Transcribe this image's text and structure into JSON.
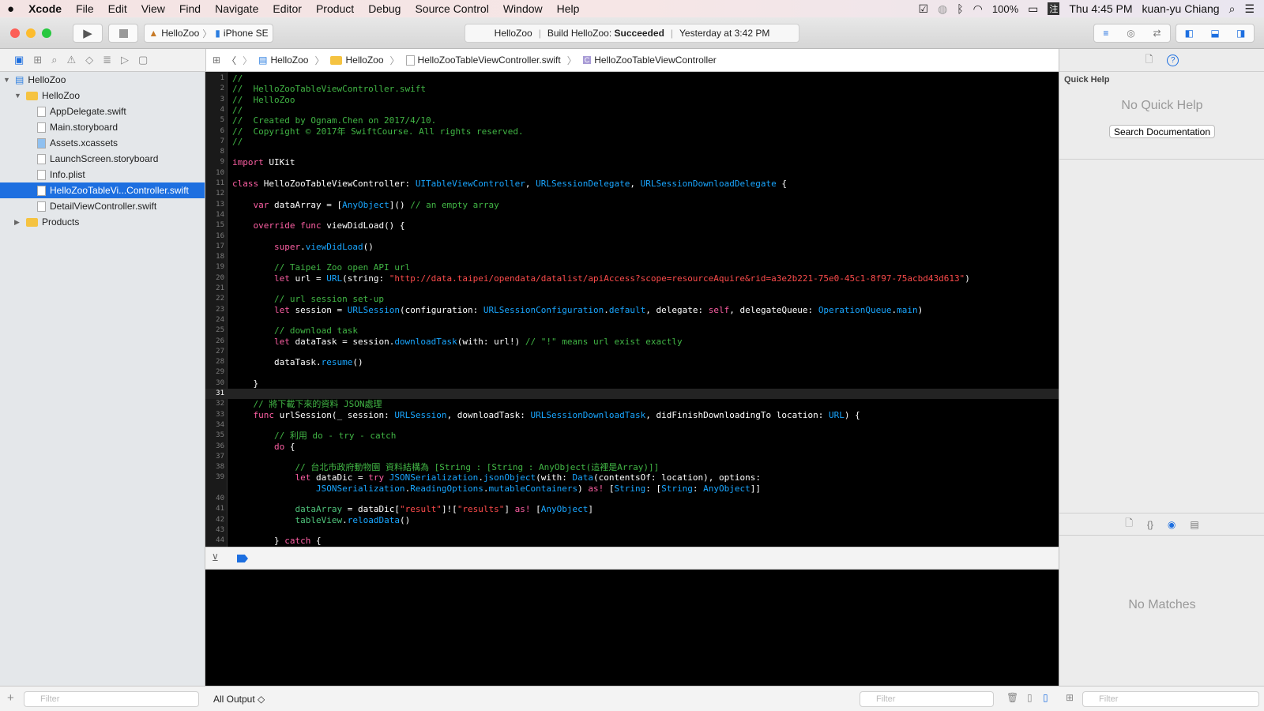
{
  "menubar": {
    "app": "Xcode",
    "items": [
      "File",
      "Edit",
      "View",
      "Find",
      "Navigate",
      "Editor",
      "Product",
      "Debug",
      "Source Control",
      "Window",
      "Help"
    ],
    "battery": "100%",
    "clock": "Thu 4:45 PM",
    "user": "kuan-yu Chiang",
    "input_method": "注"
  },
  "toolbar": {
    "scheme": "HelloZoo",
    "device": "iPhone SE",
    "status_project": "HelloZoo",
    "status_build": "Build HelloZoo: ",
    "status_result": "Succeeded",
    "status_time": "Yesterday at 3:42 PM"
  },
  "jumpbar": [
    "HelloZoo",
    "HelloZoo",
    "HelloZooTableViewController.swift",
    "HelloZooTableViewController"
  ],
  "navigator": {
    "items": [
      {
        "label": "HelloZoo",
        "type": "project",
        "indent": 0,
        "open": true
      },
      {
        "label": "HelloZoo",
        "type": "folder",
        "indent": 1,
        "open": true
      },
      {
        "label": "AppDelegate.swift",
        "type": "swift",
        "indent": 2
      },
      {
        "label": "Main.storyboard",
        "type": "file",
        "indent": 2
      },
      {
        "label": "Assets.xcassets",
        "type": "assets",
        "indent": 2
      },
      {
        "label": "LaunchScreen.storyboard",
        "type": "file",
        "indent": 2
      },
      {
        "label": "Info.plist",
        "type": "file",
        "indent": 2
      },
      {
        "label": "HelloZooTableVi...Controller.swift",
        "type": "swift",
        "indent": 2,
        "selected": true
      },
      {
        "label": "DetailViewController.swift",
        "type": "swift",
        "indent": 2
      },
      {
        "label": "Products",
        "type": "folder",
        "indent": 1,
        "open": false
      }
    ],
    "filter_placeholder": "Filter"
  },
  "editor": {
    "current_line": "31",
    "lines": [
      {
        "n": "1",
        "t": [
          [
            "//",
            "c"
          ]
        ]
      },
      {
        "n": "2",
        "t": [
          [
            "//  HelloZooTableViewController.swift",
            "c"
          ]
        ]
      },
      {
        "n": "3",
        "t": [
          [
            "//  HelloZoo",
            "c"
          ]
        ]
      },
      {
        "n": "4",
        "t": [
          [
            "//",
            "c"
          ]
        ]
      },
      {
        "n": "5",
        "t": [
          [
            "//  Created by Ognam.Chen on 2017/4/10.",
            "c"
          ]
        ]
      },
      {
        "n": "6",
        "t": [
          [
            "//  Copyright © 2017年 SwiftCourse. All rights reserved.",
            "c"
          ]
        ]
      },
      {
        "n": "7",
        "t": [
          [
            "//",
            "c"
          ]
        ]
      },
      {
        "n": "8",
        "t": []
      },
      {
        "n": "9",
        "t": [
          [
            "import",
            "k"
          ],
          [
            " UIKit",
            "p"
          ]
        ]
      },
      {
        "n": "10",
        "t": []
      },
      {
        "n": "11",
        "t": [
          [
            "class",
            "k"
          ],
          [
            " HelloZooTableViewController: ",
            "p"
          ],
          [
            "UITableViewController",
            "t"
          ],
          [
            ", ",
            "p"
          ],
          [
            "URLSessionDelegate",
            "t"
          ],
          [
            ", ",
            "p"
          ],
          [
            "URLSessionDownloadDelegate",
            "t"
          ],
          [
            " {",
            "p"
          ]
        ]
      },
      {
        "n": "12",
        "t": []
      },
      {
        "n": "13",
        "t": [
          [
            "    ",
            "p"
          ],
          [
            "var",
            "k"
          ],
          [
            " dataArray = [",
            "p"
          ],
          [
            "AnyObject",
            "t"
          ],
          [
            "]() ",
            "p"
          ],
          [
            "// an empty array",
            "c"
          ]
        ]
      },
      {
        "n": "14",
        "t": []
      },
      {
        "n": "15",
        "t": [
          [
            "    ",
            "p"
          ],
          [
            "override func",
            "k"
          ],
          [
            " viewDidLoad() {",
            "p"
          ]
        ]
      },
      {
        "n": "16",
        "t": []
      },
      {
        "n": "17",
        "t": [
          [
            "        ",
            "p"
          ],
          [
            "super",
            "k"
          ],
          [
            ".",
            "p"
          ],
          [
            "viewDidLoad",
            "t"
          ],
          [
            "()",
            "p"
          ]
        ]
      },
      {
        "n": "18",
        "t": []
      },
      {
        "n": "19",
        "t": [
          [
            "        // Taipei Zoo open API url",
            "c"
          ]
        ]
      },
      {
        "n": "20",
        "t": [
          [
            "        ",
            "p"
          ],
          [
            "let",
            "k"
          ],
          [
            " url = ",
            "p"
          ],
          [
            "URL",
            "t"
          ],
          [
            "(string: ",
            "p"
          ],
          [
            "\"http://data.taipei/opendata/datalist/apiAccess?scope=resourceAquire&rid=a3e2b221-75e0-45c1-8f97-75acbd43d613\"",
            "s"
          ],
          [
            ")",
            "p"
          ]
        ]
      },
      {
        "n": "21",
        "t": []
      },
      {
        "n": "22",
        "t": [
          [
            "        // url session set-up",
            "c"
          ]
        ]
      },
      {
        "n": "23",
        "t": [
          [
            "        ",
            "p"
          ],
          [
            "let",
            "k"
          ],
          [
            " session = ",
            "p"
          ],
          [
            "URLSession",
            "t"
          ],
          [
            "(configuration: ",
            "p"
          ],
          [
            "URLSessionConfiguration",
            "t"
          ],
          [
            ".",
            "p"
          ],
          [
            "default",
            "t"
          ],
          [
            ", delegate: ",
            "p"
          ],
          [
            "self",
            "k"
          ],
          [
            ", delegateQueue: ",
            "p"
          ],
          [
            "OperationQueue",
            "t"
          ],
          [
            ".",
            "p"
          ],
          [
            "main",
            "t"
          ],
          [
            ")",
            "p"
          ]
        ]
      },
      {
        "n": "24",
        "t": []
      },
      {
        "n": "25",
        "t": [
          [
            "        // download task",
            "c"
          ]
        ]
      },
      {
        "n": "26",
        "t": [
          [
            "        ",
            "p"
          ],
          [
            "let",
            "k"
          ],
          [
            " dataTask = session.",
            "p"
          ],
          [
            "downloadTask",
            "t"
          ],
          [
            "(with: url!) ",
            "p"
          ],
          [
            "// \"!\" means url exist exactly",
            "c"
          ]
        ]
      },
      {
        "n": "27",
        "t": []
      },
      {
        "n": "28",
        "t": [
          [
            "        dataTask.",
            "p"
          ],
          [
            "resume",
            "t"
          ],
          [
            "()",
            "p"
          ]
        ]
      },
      {
        "n": "29",
        "t": []
      },
      {
        "n": "30",
        "t": [
          [
            "    }",
            "p"
          ]
        ]
      },
      {
        "n": "31",
        "t": []
      },
      {
        "n": "32",
        "t": [
          [
            "    // 將下載下來的資料 JSON處理",
            "c"
          ]
        ]
      },
      {
        "n": "33",
        "t": [
          [
            "    ",
            "p"
          ],
          [
            "func",
            "k"
          ],
          [
            " urlSession(_ session: ",
            "p"
          ],
          [
            "URLSession",
            "t"
          ],
          [
            ", downloadTask: ",
            "p"
          ],
          [
            "URLSessionDownloadTask",
            "t"
          ],
          [
            ", didFinishDownloadingTo location: ",
            "p"
          ],
          [
            "URL",
            "t"
          ],
          [
            ") {",
            "p"
          ]
        ]
      },
      {
        "n": "34",
        "t": []
      },
      {
        "n": "35",
        "t": [
          [
            "        // 利用 do - try - catch",
            "c"
          ]
        ]
      },
      {
        "n": "36",
        "t": [
          [
            "        ",
            "p"
          ],
          [
            "do",
            "k"
          ],
          [
            " {",
            "p"
          ]
        ]
      },
      {
        "n": "37",
        "t": []
      },
      {
        "n": "38",
        "t": [
          [
            "            // 台北市政府動物園 資料結構為 [String : [String : AnyObject(這裡是Array)]]",
            "c"
          ]
        ]
      },
      {
        "n": "39",
        "t": [
          [
            "            ",
            "p"
          ],
          [
            "let",
            "k"
          ],
          [
            " dataDic = ",
            "p"
          ],
          [
            "try",
            "k"
          ],
          [
            " ",
            "p"
          ],
          [
            "JSONSerialization",
            "t"
          ],
          [
            ".",
            "p"
          ],
          [
            "jsonObject",
            "t"
          ],
          [
            "(with: ",
            "p"
          ],
          [
            "Data",
            "t"
          ],
          [
            "(contentsOf: location), options:",
            "p"
          ]
        ]
      },
      {
        "n": "",
        "t": [
          [
            "                ",
            "p"
          ],
          [
            "JSONSerialization",
            "t"
          ],
          [
            ".",
            "p"
          ],
          [
            "ReadingOptions",
            "t"
          ],
          [
            ".",
            "p"
          ],
          [
            "mutableContainers",
            "t"
          ],
          [
            ") ",
            "p"
          ],
          [
            "as!",
            "k"
          ],
          [
            " [",
            "p"
          ],
          [
            "String",
            "t"
          ],
          [
            ": [",
            "p"
          ],
          [
            "String",
            "t"
          ],
          [
            ": ",
            "p"
          ],
          [
            "AnyObject",
            "t"
          ],
          [
            "]]",
            "p"
          ]
        ]
      },
      {
        "n": "40",
        "t": []
      },
      {
        "n": "41",
        "t": [
          [
            "            ",
            "p"
          ],
          [
            "dataArray",
            "v"
          ],
          [
            " = dataDic[",
            "p"
          ],
          [
            "\"result\"",
            "s"
          ],
          [
            "]![",
            "p"
          ],
          [
            "\"results\"",
            "s"
          ],
          [
            "] ",
            "p"
          ],
          [
            "as!",
            "k"
          ],
          [
            " [",
            "p"
          ],
          [
            "AnyObject",
            "t"
          ],
          [
            "]",
            "p"
          ]
        ]
      },
      {
        "n": "42",
        "t": [
          [
            "            ",
            "p"
          ],
          [
            "tableView",
            "v"
          ],
          [
            ".",
            "p"
          ],
          [
            "reloadData",
            "t"
          ],
          [
            "()",
            "p"
          ]
        ]
      },
      {
        "n": "43",
        "t": []
      },
      {
        "n": "44",
        "t": [
          [
            "        } ",
            "p"
          ],
          [
            "catch",
            "k"
          ],
          [
            " {",
            "p"
          ]
        ]
      }
    ]
  },
  "debug": {
    "output_selector": "All Output ◇",
    "filter_placeholder": "Filter"
  },
  "inspector": {
    "title": "Quick Help",
    "empty": "No Quick Help",
    "search_button": "Search Documentation",
    "no_matches": "No Matches",
    "filter_placeholder": "Filter"
  },
  "colors": {
    "accent": "#1d6fe0",
    "comment": "#41b645",
    "keyword": "#fc5fa3",
    "type": "#19a6ff",
    "string": "#fc4b4b"
  }
}
